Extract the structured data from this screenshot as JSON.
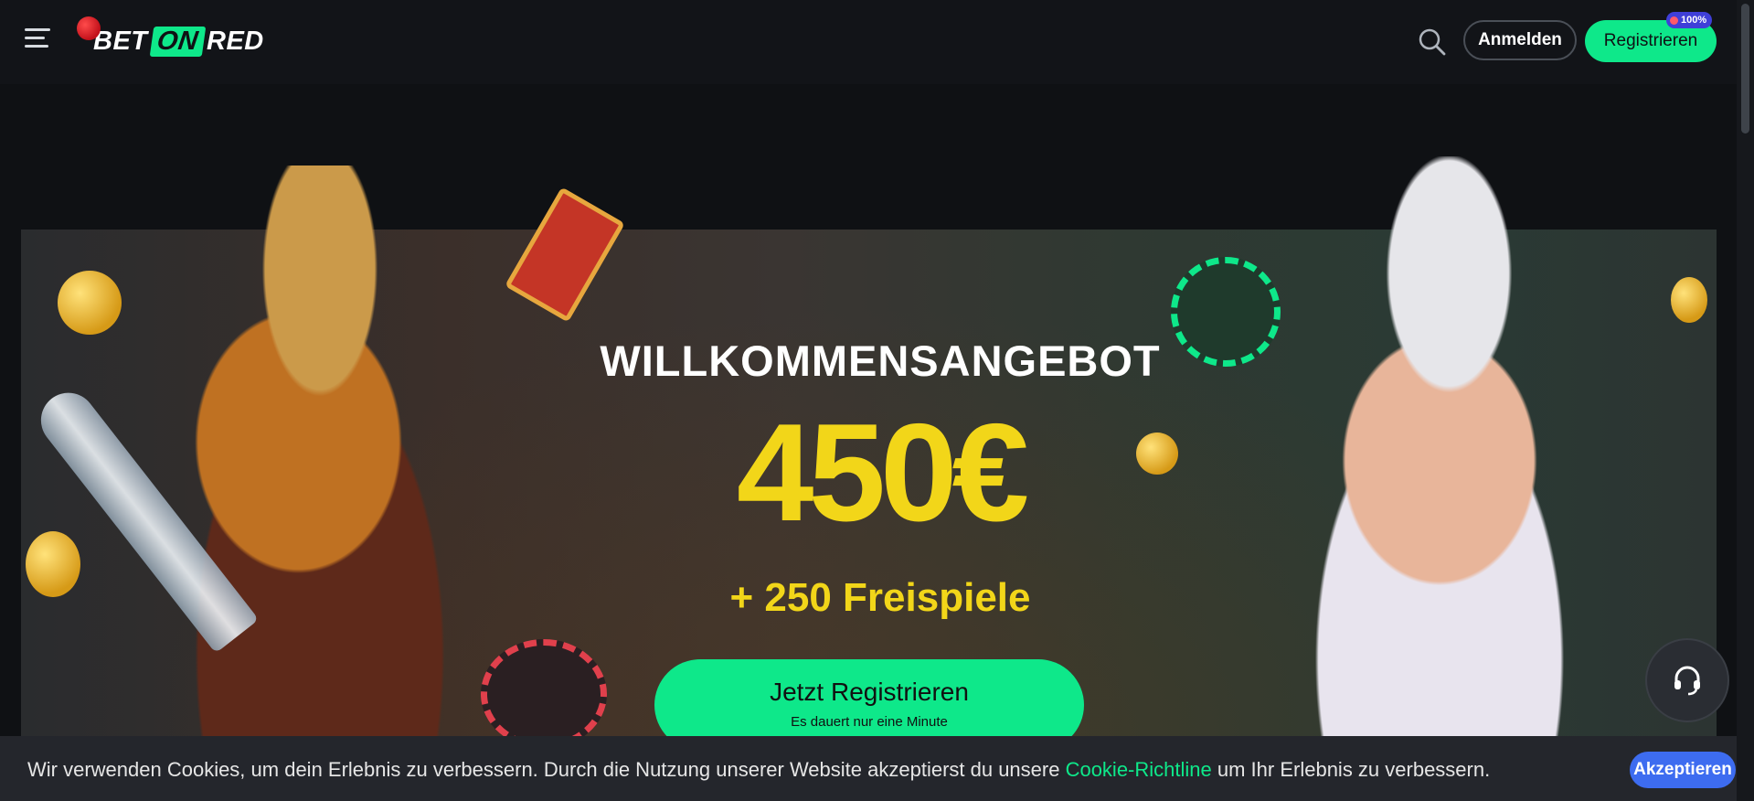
{
  "header": {
    "logo": {
      "part1": "BET",
      "part2": "ON",
      "part3": "RED"
    },
    "login_label": "Anmelden",
    "register_label": "Registrieren",
    "badge_text": "100%"
  },
  "hero": {
    "title": "WILLKOMMENSANGEBOT",
    "amount": "450€",
    "spins": "+ 250 Freispiele",
    "cta_label": "Jetzt Registrieren",
    "cta_sub": "Es dauert nur eine Minute"
  },
  "cookie": {
    "text_before": "Wir verwenden Cookies, um dein Erlebnis zu verbessern. Durch die Nutzung unserer Website akzeptierst du unsere ",
    "link_text": "Cookie-Richtline",
    "text_after": " um Ihr Erlebnis zu verbessern.",
    "accept_label": "Akzeptieren"
  },
  "colors": {
    "accent_green": "#0ee88a",
    "amount_yellow": "#f2d619",
    "accept_blue": "#3d6cf0"
  }
}
